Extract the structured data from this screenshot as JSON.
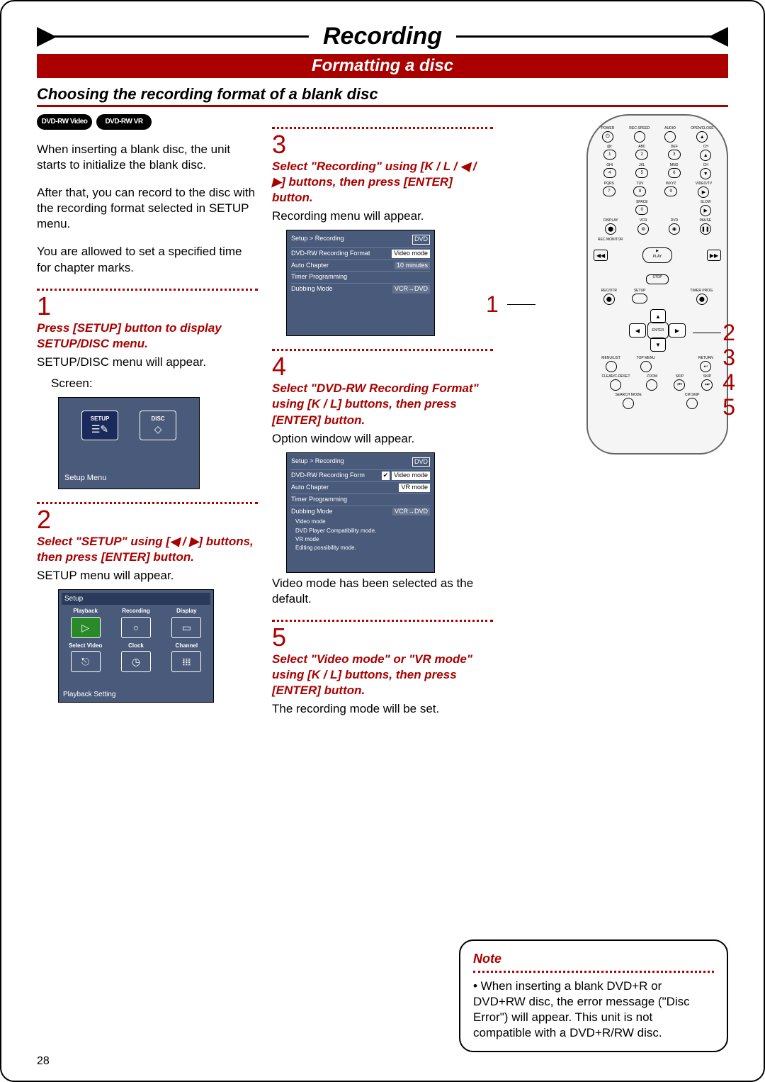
{
  "header": {
    "title": "Recording",
    "subtitle": "Formatting a disc",
    "section": "Choosing the recording format of a blank disc"
  },
  "badges": [
    "DVD-RW Video",
    "DVD-RW VR"
  ],
  "intro": {
    "p1": "When inserting a blank disc, the unit starts to initialize the blank disc.",
    "p2": "After that, you can record to the disc with the recording format selected in SETUP menu.",
    "p3": "You are allowed to set a specified time for chapter marks."
  },
  "steps": {
    "s1": {
      "num": "1",
      "head": "Press [SETUP] button to display SETUP/DISC menu.",
      "body": "SETUP/DISC menu will appear.",
      "body2": "Screen:"
    },
    "s2": {
      "num": "2",
      "head": "Select \"SETUP\" using [◀ / ▶] buttons, then press [ENTER] button.",
      "body": "SETUP menu will appear."
    },
    "s3": {
      "num": "3",
      "head": "Select \"Recording\" using [K / L / ◀ / ▶] buttons, then press [ENTER] button.",
      "body": "Recording menu will appear."
    },
    "s4": {
      "num": "4",
      "head": "Select \"DVD-RW Recording Format\" using [K / L] buttons, then press [ENTER] button.",
      "body": "Option window will appear.",
      "body2": "Video mode has been selected as the default."
    },
    "s5": {
      "num": "5",
      "head": "Select \"Video mode\" or \"VR mode\" using [K / L] buttons, then press [ENTER] button.",
      "body": "The recording mode will be set."
    }
  },
  "shot1": {
    "setup": "SETUP",
    "disc": "DISC",
    "caption": "Setup Menu"
  },
  "shot2": {
    "hdr": "Setup",
    "cells": [
      "Playback",
      "Recording",
      "Display",
      "Select Video",
      "Clock",
      "Channel"
    ],
    "caption": "Playback Setting"
  },
  "shot3": {
    "hdr": "Setup > Recording",
    "tag": "DVD",
    "rows": [
      {
        "k": "DVD-RW Recording Format",
        "v": "Video mode"
      },
      {
        "k": "Auto Chapter",
        "v": "10 minutes"
      },
      {
        "k": "Timer Programming",
        "v": ""
      },
      {
        "k": "Dubbing Mode",
        "v": "VCR→DVD"
      }
    ]
  },
  "shot4": {
    "hdr": "Setup > Recording",
    "tag": "DVD",
    "rows": [
      {
        "k": "DVD-RW Recording Form",
        "v": "Video mode",
        "sel": true
      },
      {
        "k": "Auto Chapter",
        "v": "VR mode"
      },
      {
        "k": "Timer Programming",
        "v": ""
      },
      {
        "k": "Dubbing Mode",
        "v": "VCR→DVD"
      }
    ],
    "notes": [
      "Video mode",
      "  DVD Player Compatibility mode.",
      "VR mode",
      "  Editing possibility mode."
    ]
  },
  "remote": {
    "row1": [
      "POWER",
      "REC SPEED",
      "AUDIO",
      "OPEN/CLOSE"
    ],
    "row2": [
      "@/:",
      "ABC",
      "DEF",
      "CH"
    ],
    "nums2": [
      "1",
      "2",
      "3",
      "▲"
    ],
    "row3": [
      "GHI",
      "JKL",
      "MNO",
      "CH"
    ],
    "nums3": [
      "4",
      "5",
      "6",
      "▼"
    ],
    "row4": [
      "PQRS",
      "TUV",
      "WXYZ",
      "VIDEO/TV"
    ],
    "nums4": [
      "7",
      "8",
      "9",
      "▶"
    ],
    "row5l": "SPACE",
    "row5r": "SLOW",
    "num5": "0",
    "row6": [
      "DISPLAY",
      "VCR",
      "DVD",
      "PAUSE"
    ],
    "sec1": "REC MONITOR",
    "play": "PLAY",
    "nav": [
      "◀◀",
      "▶▶"
    ],
    "stop": "STOP",
    "row7": [
      "REC/OTR",
      "SETUP",
      "",
      "TIMER PROG."
    ],
    "dpad_center": "ENTER",
    "row8": [
      "MENU/LIST",
      "TOP MENU",
      "",
      "RETURN"
    ],
    "row9": [
      "CLEAR/C-RESET",
      "ZOOM",
      "SKIP",
      "SKIP"
    ],
    "row10": [
      "SEARCH MODE",
      "CM SKIP",
      "",
      ""
    ]
  },
  "callouts": {
    "c1": "1",
    "c2": "2",
    "c3": "3",
    "c4": "4",
    "c5": "5"
  },
  "note": {
    "title": "Note",
    "text": "• When inserting a blank DVD+R or DVD+RW disc, the error message (\"Disc Error\") will appear. This unit is not compatible with a DVD+R/RW disc."
  },
  "page_num": "28"
}
